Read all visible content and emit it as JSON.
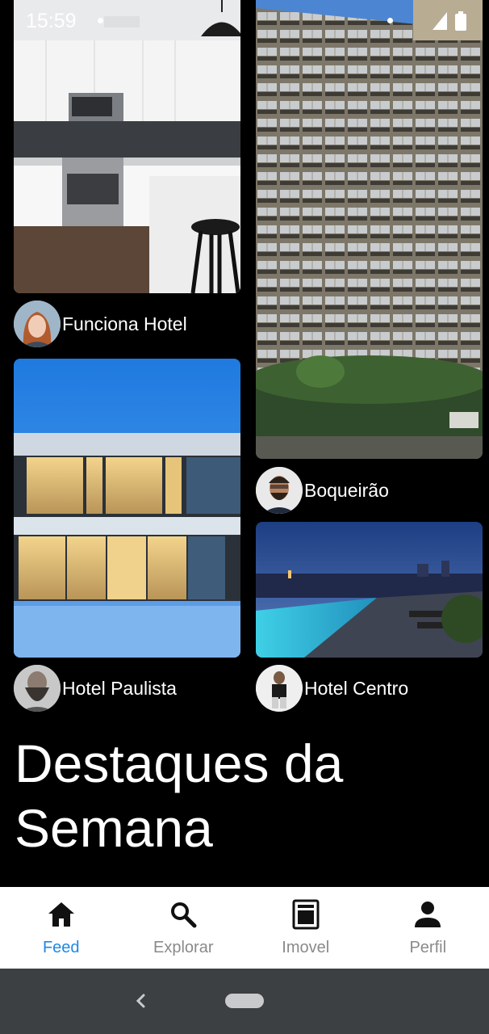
{
  "status_bar": {
    "time": "15:59"
  },
  "feed": {
    "cards": [
      {
        "id": "kitchen",
        "owner": "Funciona Hotel"
      },
      {
        "id": "tower",
        "owner": "Boqueirão"
      },
      {
        "id": "glass-house",
        "owner": "Hotel Paulista"
      },
      {
        "id": "rooftop-pool",
        "owner": "Hotel Centro"
      }
    ]
  },
  "section": {
    "title": "Destaques da Semana"
  },
  "bottom_nav": {
    "items": [
      {
        "label": "Feed",
        "icon": "home-icon",
        "active": true
      },
      {
        "label": "Explorar",
        "icon": "search-icon",
        "active": false
      },
      {
        "label": "Imovel",
        "icon": "document-icon",
        "active": false
      },
      {
        "label": "Perfil",
        "icon": "person-icon",
        "active": false
      }
    ]
  },
  "colors": {
    "active": "#1e88e5",
    "inactive": "#8a8a8a",
    "nav_bg": "#ffffff",
    "system_nav": "#3c4043"
  }
}
